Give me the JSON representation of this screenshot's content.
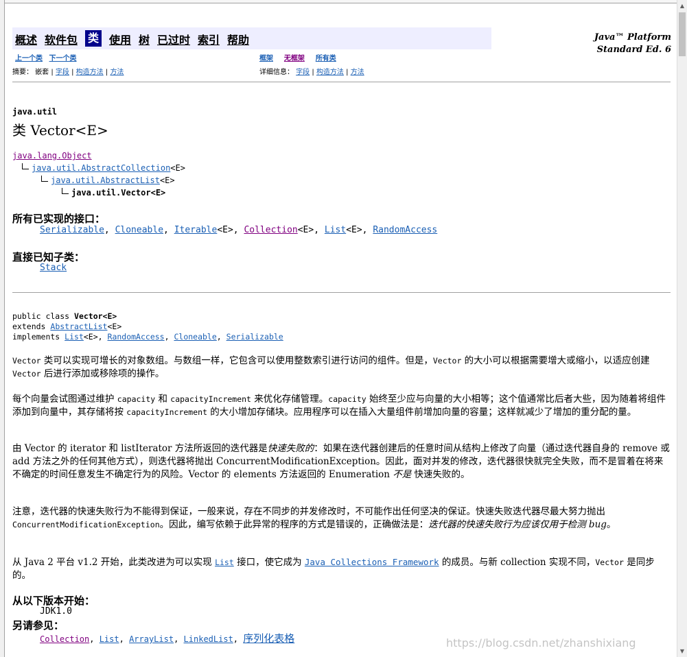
{
  "navbar": {
    "items": [
      "概述",
      "软件包",
      "类",
      "使用",
      "树",
      "已过时",
      "索引",
      "帮助"
    ],
    "current": "类",
    "platform_line1": "Java™ Platform",
    "platform_line2": "Standard Ed. 6"
  },
  "subnav": {
    "prev_class": "上一个类",
    "next_class": "下一个类",
    "frames": "框架",
    "no_frames": "无框架",
    "all_classes": "所有类",
    "summary_label": "摘要：",
    "summary_nested": "嵌套",
    "summary_field": "字段",
    "summary_constr": "构造方法",
    "summary_method": "方法",
    "detail_label": "详细信息：",
    "detail_field": "字段",
    "detail_constr": "构造方法",
    "detail_method": "方法",
    "sep": "|"
  },
  "header": {
    "package": "java.util",
    "class_title": "类 Vector<E>"
  },
  "hierarchy": {
    "level0": "java.lang.Object",
    "level1_link": "java.util.AbstractCollection",
    "level1_suffix": "<E>",
    "level2_link": "java.util.AbstractList",
    "level2_suffix": "<E>",
    "level3": "java.util.Vector<E>"
  },
  "interfaces": {
    "label": "所有已实现的接口：",
    "items": [
      "Serializable",
      "Cloneable",
      "Iterable",
      "Collection",
      "List",
      "RandomAccess"
    ],
    "generic": "<E>",
    "comma": ", "
  },
  "subclasses": {
    "label": "直接已知子类：",
    "items": [
      "Stack"
    ]
  },
  "signature": {
    "line1_prefix": "public class ",
    "line1_name": "Vector<E>",
    "line2_prefix": "extends ",
    "line2_link": "AbstractList",
    "line2_suffix": "<E>",
    "line3_prefix": "implements ",
    "line3_links": [
      "List",
      "RandomAccess",
      "Cloneable",
      "Serializable"
    ],
    "generic": "<E>",
    "comma": ", "
  },
  "paragraphs": {
    "p1": [
      "Vector",
      " 类可以实现可增长的对象数组。与数组一样，它包含可以使用整数索引进行访问的组件。但是，",
      "Vector",
      " 的大小可以根据需要增大或缩小，以适应创建 ",
      "Vector",
      " 后进行添加或移除项的操作。"
    ],
    "p2": [
      "每个向量会试图通过维护 ",
      "capacity",
      " 和 ",
      "capacityIncrement",
      " 来优化存储管理。",
      "capacity",
      " 始终至少应与向量的大小相等；这个值通常比后者大些，因为随着将组件添加到向量中，其存储将按 ",
      "capacityIncrement",
      " 的大小增加存储块。应用程序可以在插入大量组件前增加向量的容量；这样就减少了增加的重分配的量。"
    ],
    "p3": [
      "由 Vector 的 iterator 和 listIterator 方法所返回的迭代器是",
      "快速失败的",
      "：如果在迭代器创建后的任意时间从结构上修改了向量（通过迭代器自身的 remove 或 add 方法之外的任何其他方式），则迭代器将抛出 ConcurrentModificationException。因此，面对并发的修改，迭代器很快就完全失败，而不是冒着在将来不确定的时间任意发生不确定行为的风险。Vector 的 elements 方法返回的 Enumeration ",
      "不是",
      " 快速失败的。"
    ],
    "p4": [
      "注意，迭代器的快速失败行为不能得到保证，一般来说，存在不同步的并发修改时，不可能作出任何坚决的保证。快速失败迭代器尽最大努力抛出 ",
      "ConcurrentModificationException",
      "。因此，编写依赖于此异常的程序的方式是错误的，正确做法是：",
      "迭代器的快速失败行为应该仅用于检测 bug",
      "。"
    ],
    "p5": [
      "从 Java 2 平台 v1.2 开始，此类改进为可以实现 ",
      "List",
      " 接口，使它成为 ",
      "Java Collections Framework",
      " 的成员。与新 collection 实现不同，",
      "Vector",
      " 是同步的。"
    ]
  },
  "since": {
    "label": "从以下版本开始：",
    "value": "JDK1.0"
  },
  "see_also": {
    "label": "另请参见：",
    "items": [
      "Collection",
      "List",
      "ArrayList",
      "LinkedList",
      "序列化表格"
    ],
    "comma": ", "
  },
  "watermark": "https://blog.csdn.net/zhanshixiang",
  "scrollbar": {
    "up": "▲",
    "down": "▼"
  }
}
